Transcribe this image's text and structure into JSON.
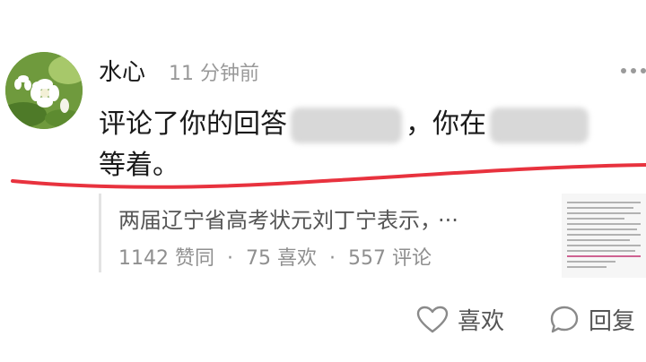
{
  "comment": {
    "username": "水心",
    "timestamp": "11 分钟前",
    "text_part1": "评论了你的回答",
    "text_part2": "，你在",
    "text_part3": "等着。"
  },
  "quote": {
    "title": "两届辽宁省高考状元刘丁宁表示，",
    "ellipsis": "···",
    "likes": "1142 赞同",
    "favorites": "75 喜欢",
    "comments": "557 评论",
    "separator": "·"
  },
  "actions": {
    "like_label": "喜欢",
    "reply_label": "回复"
  },
  "colors": {
    "annotation_line": "#e8323e",
    "avatar_background": "#7fa64a"
  },
  "icons": {
    "avatar": "jasmine-flower-photo",
    "more": "more-dots-icon",
    "like": "heart-outline-icon",
    "reply": "speech-bubble-icon"
  }
}
